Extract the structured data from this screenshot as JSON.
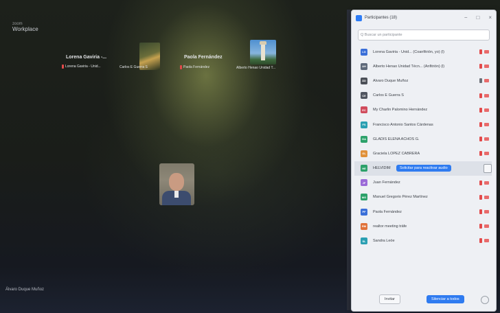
{
  "workspace": {
    "small_label": "zoom",
    "title": "Workplace"
  },
  "tiles": [
    {
      "big_name": "Lorena Gaviria -...",
      "small_name": "Lorena Gaviria - Unid..."
    },
    {
      "small_name": "Carlos E Guerra S"
    },
    {
      "big_name": "Paola Fernández",
      "small_name": "Paola Fernández"
    },
    {
      "small_name": "Alberto Henao Unidad T..."
    }
  ],
  "self_view": {
    "name": "Álvaro Duque Muñoz"
  },
  "panel": {
    "title": "Participantes (18)",
    "window_buttons": [
      "−",
      "□",
      "×"
    ],
    "search_placeholder": "Q Buscar un participante",
    "participants": [
      {
        "initials": "LG",
        "color": "#3a6fd8",
        "name": "Lorena Gaviria - Unid... (Coanfitrión, yo) (l)",
        "mic": "red"
      },
      {
        "initials": "AH",
        "color": "#5f6a7a",
        "name": "Alberto Henao Unidad Técn... (Anfitrión) (l)",
        "mic": "red"
      },
      {
        "initials": "ÁD",
        "color": "#4b4f57",
        "name": "Álvaro Duque Muñoz",
        "mic": "gray"
      },
      {
        "initials": "CE",
        "color": "#505560",
        "name": "Carlos E Guerra S",
        "mic": "red"
      },
      {
        "initials": "EC",
        "color": "#d04b5c",
        "name": "My Charlin Palomino Hernández",
        "mic": "red"
      },
      {
        "initials": "FS",
        "color": "#2a9fb2",
        "name": "Francisco Antonio Santos Cárdenas",
        "mic": "red"
      },
      {
        "initials": "GA",
        "color": "#2ca16a",
        "name": "GLADIS ELENA ACHOS G.",
        "mic": "red"
      },
      {
        "initials": "GL",
        "color": "#e0913a",
        "name": "Graciela LÓPEZ CABRERA",
        "mic": "red"
      },
      {
        "initials": "HE",
        "color": "#2ca16a",
        "name": "HELVIDIM",
        "mic": "none",
        "highlight": true,
        "ask_label": "Solicitar para reactivar audio"
      },
      {
        "initials": "JF",
        "color": "#9b6ad8",
        "name": "Juan Fernández",
        "mic": "red"
      },
      {
        "initials": "MG",
        "color": "#2ca16a",
        "name": "Manuel Gregorio Pérez Martínez",
        "mic": "red"
      },
      {
        "initials": "PF",
        "color": "#3a6fd8",
        "name": "Paola Fernández",
        "mic": "red"
      },
      {
        "initials": "RM",
        "color": "#e0723a",
        "name": "realtor meeting träfe",
        "mic": "red"
      },
      {
        "initials": "SL",
        "color": "#2a9fb2",
        "name": "Sandra Leóe",
        "mic": "red"
      }
    ],
    "footer": {
      "invite": "Invitar",
      "mute_all": "Silenciar a todos"
    }
  }
}
